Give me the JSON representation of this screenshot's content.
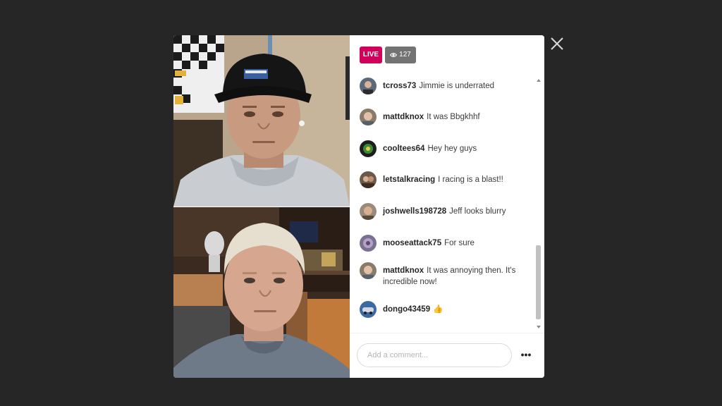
{
  "header": {
    "live_label": "LIVE",
    "viewer_count": "127"
  },
  "comments": [
    {
      "username": "tcross73",
      "message": "Jimmie is underrated",
      "avatar_color": "#5a6a7a"
    },
    {
      "username": "mattdknox",
      "message": "It was Bbgkhhf",
      "avatar_color": "#8a7a6a"
    },
    {
      "username": "cooltees64",
      "message": "Hey hey guys",
      "avatar_color": "#2b2b2b"
    },
    {
      "username": "letstalkracing",
      "message": "I racing is a blast!!",
      "avatar_color": "#6a5a4a"
    },
    {
      "username": "joshwells198728",
      "message": "Jeff looks blurry",
      "avatar_color": "#9a8a7a"
    },
    {
      "username": "mooseattack75",
      "message": "For sure",
      "avatar_color": "#7a7090"
    },
    {
      "username": "mattdknox",
      "message": "It was annoying then. It's incredible now!",
      "avatar_color": "#8a7a6a"
    },
    {
      "username": "dongo43459",
      "message": "👍",
      "avatar_color": "#3a6aa0"
    }
  ],
  "footer": {
    "comment_placeholder": "Add a comment...",
    "more_label": "•••"
  },
  "colors": {
    "live_badge": "#d1005b",
    "viewer_badge": "#737373",
    "backdrop": "#262626"
  },
  "icons": {
    "close": "close-icon",
    "viewers": "eye-icon",
    "more": "more-options-icon"
  }
}
